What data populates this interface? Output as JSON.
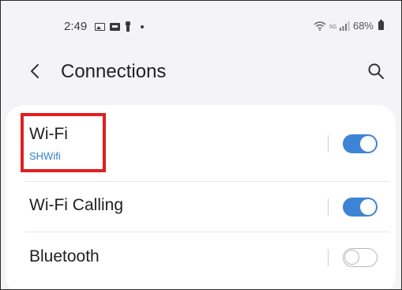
{
  "status_bar": {
    "time": "2:49",
    "battery": "68%",
    "icons_left": [
      "image-icon",
      "gallery-icon",
      "person-icon",
      "dot-icon"
    ],
    "icons_right": [
      "wifi-signal-icon",
      "signal-bars-icon",
      "battery-icon"
    ]
  },
  "app_bar": {
    "title": "Connections",
    "back_icon": "back-chevron-icon",
    "search_icon": "search-icon"
  },
  "settings": [
    {
      "title": "Wi-Fi",
      "subtitle": "SHWifi",
      "toggle_on": true,
      "highlighted": true
    },
    {
      "title": "Wi-Fi Calling",
      "toggle_on": true
    },
    {
      "title": "Bluetooth",
      "toggle_on": false
    }
  ],
  "colors": {
    "accent": "#3e84d6",
    "subtitle": "#2f7fc9",
    "highlight": "#e0201f",
    "background": "#f4f4f6",
    "card": "#ffffff"
  }
}
